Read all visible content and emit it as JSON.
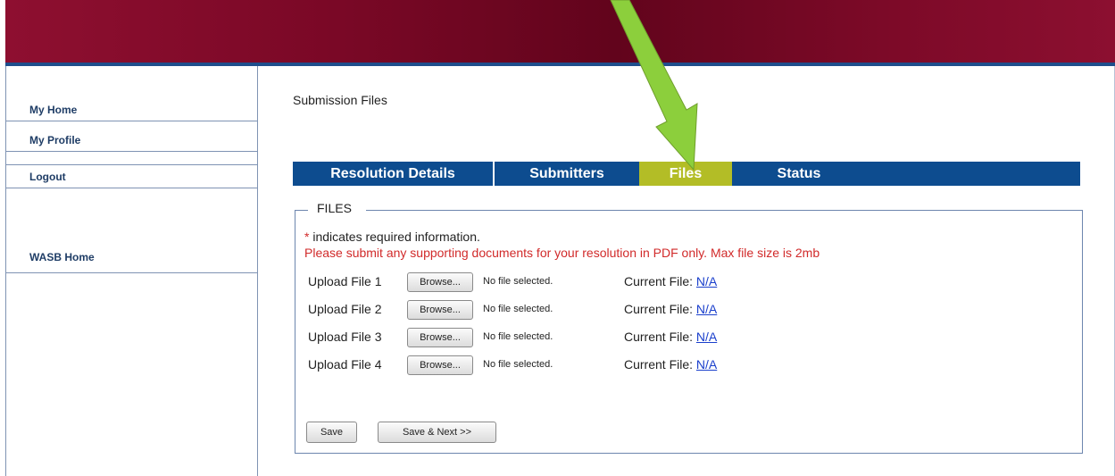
{
  "sidebar": {
    "items": [
      {
        "label": "My Home"
      },
      {
        "label": "My Profile"
      },
      {
        "label": "Logout"
      },
      {
        "label": "WASB Home"
      }
    ]
  },
  "page": {
    "title": "Submission Files"
  },
  "tabs": [
    {
      "label": "Resolution Details",
      "active": false
    },
    {
      "label": "Submitters",
      "active": false
    },
    {
      "label": "Files",
      "active": true
    },
    {
      "label": "Status",
      "active": false
    }
  ],
  "files_section": {
    "legend": "FILES",
    "required_star": "*",
    "required_note": " indicates required information.",
    "instruction": "Please submit any supporting documents for your resolution in PDF only. Max file size is 2mb",
    "uploads": [
      {
        "label": "Upload File 1",
        "browse": "Browse...",
        "status": "No file selected.",
        "current_label": "Current File:",
        "current_value": "N/A"
      },
      {
        "label": "Upload File 2",
        "browse": "Browse...",
        "status": "No file selected.",
        "current_label": "Current File:",
        "current_value": "N/A"
      },
      {
        "label": "Upload File 3",
        "browse": "Browse...",
        "status": "No file selected.",
        "current_label": "Current File:",
        "current_value": "N/A"
      },
      {
        "label": "Upload File 4",
        "browse": "Browse...",
        "status": "No file selected.",
        "current_label": "Current File:",
        "current_value": "N/A"
      }
    ],
    "save_label": "Save",
    "save_next_label": "Save & Next >>"
  },
  "colors": {
    "banner": "#7a0826",
    "tab_bar": "#0d4c8f",
    "active_tab": "#b3bd26",
    "warning_text": "#d12a2a",
    "annotation_arrow": "#8ccf3c"
  }
}
